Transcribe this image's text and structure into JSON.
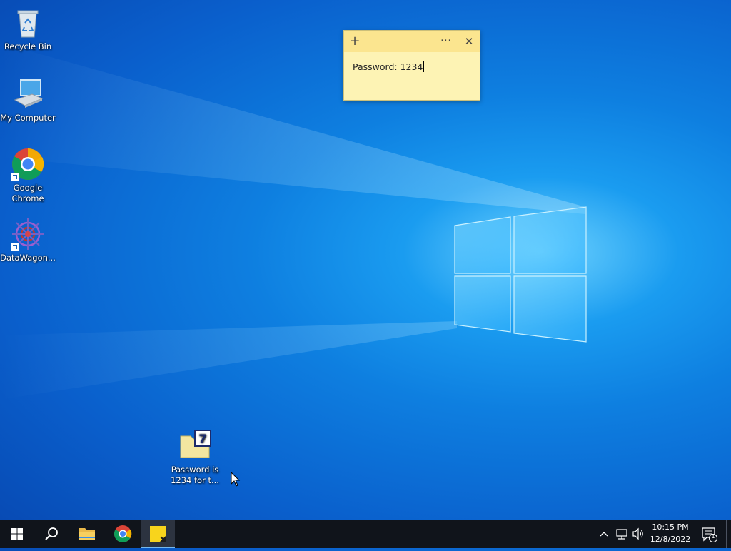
{
  "desktop": {
    "icons": [
      {
        "label": "Recycle Bin",
        "icon": "recycle-bin-icon"
      },
      {
        "label": "My Computer",
        "icon": "computer-icon"
      },
      {
        "label": "Google Chrome",
        "icon": "chrome-icon"
      },
      {
        "label": "DataWagon...",
        "icon": "datawagon-icon"
      },
      {
        "label": "Password is 1234 for t...",
        "icon": "7zip-archive-icon"
      }
    ]
  },
  "sticky_note": {
    "add_symbol": "+",
    "menu_symbol": "···",
    "close_symbol": "✕",
    "text": "Password: 1234"
  },
  "taskbar": {
    "clock_time": "10:15 PM",
    "clock_date": "12/8/2022",
    "notification_count": "1"
  },
  "colors": {
    "sticky_body": "#fdf3b4",
    "sticky_header": "#fbe58f",
    "taskbar": "#10141b",
    "desktop_accent": "#0e7fe0"
  }
}
